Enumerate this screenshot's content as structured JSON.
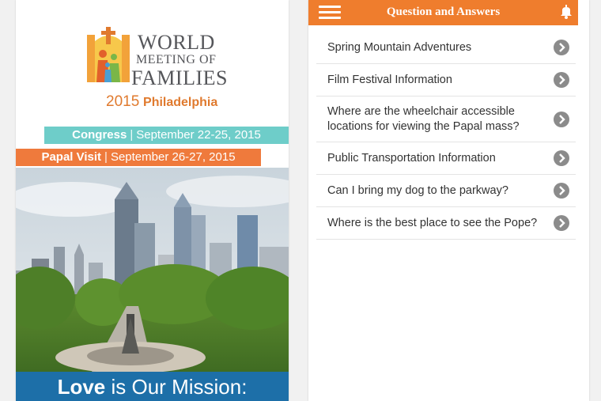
{
  "left": {
    "logo": {
      "line1": "WORLD",
      "line2": "MEETING OF",
      "line3": "FAMILIES",
      "year": "2015",
      "city": "Philadelphia"
    },
    "congress": {
      "label": "Congress",
      "dates": "September 22-25, 2015"
    },
    "papal_visit": {
      "label": "Papal Visit",
      "dates": "September 26-27, 2015"
    },
    "mission": {
      "strong": "Love",
      "rest": "is Our Mission:"
    }
  },
  "right": {
    "header_title": "Question and Answers",
    "items": [
      {
        "label": "Spring Mountain Adventures"
      },
      {
        "label": "Film Festival Information"
      },
      {
        "label": "Where are the wheelchair accessible locations for viewing the Papal mass?"
      },
      {
        "label": "Public Transportation Information"
      },
      {
        "label": "Can I bring my dog to the parkway?"
      },
      {
        "label": "Where is the best place to see the Pope?"
      }
    ]
  },
  "colors": {
    "orange": "#ef7d2d",
    "teal": "#6ecdc9",
    "blue": "#1d6fa8",
    "chevron_gray": "#8b8b8b"
  },
  "icons": [
    "menu-icon",
    "bell-icon",
    "chevron-right-icon",
    "wmf-logo-icon"
  ]
}
